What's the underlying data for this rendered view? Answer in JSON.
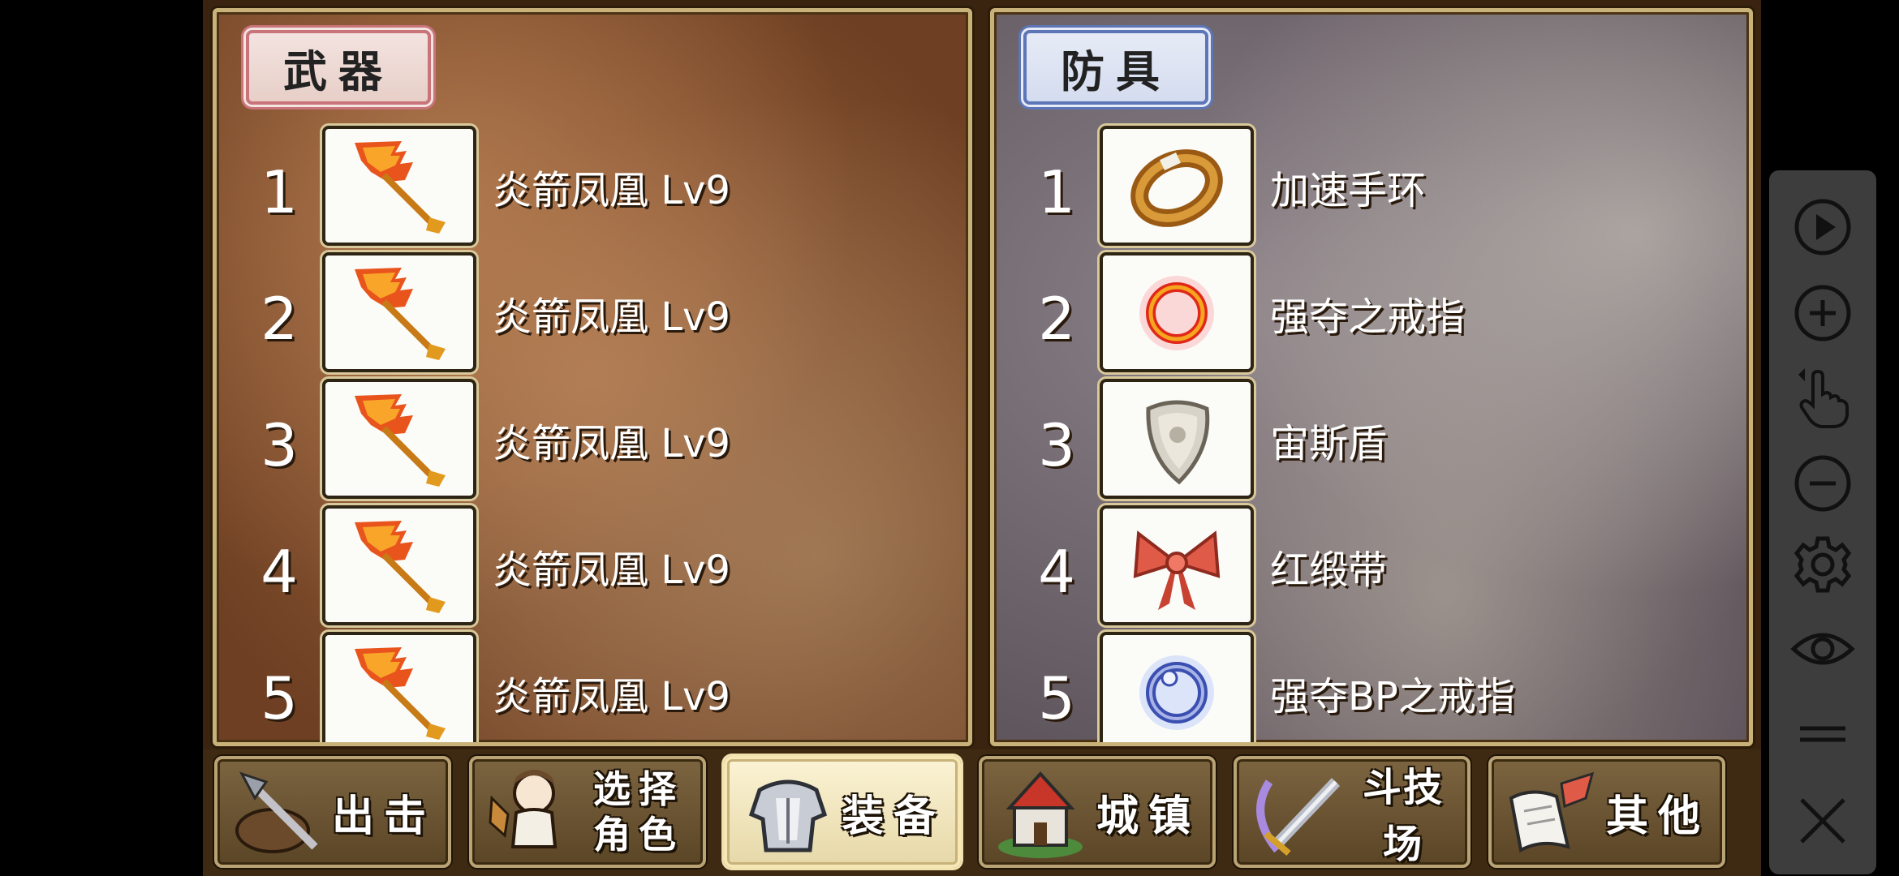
{
  "weapons": {
    "title": "武器",
    "items": [
      {
        "num": "1",
        "name": "炎箭凤凰 Lv9",
        "icon": "phoenix-flame-bow-icon"
      },
      {
        "num": "2",
        "name": "炎箭凤凰 Lv9",
        "icon": "phoenix-flame-bow-icon"
      },
      {
        "num": "3",
        "name": "炎箭凤凰 Lv9",
        "icon": "phoenix-flame-bow-icon"
      },
      {
        "num": "4",
        "name": "炎箭凤凰 Lv9",
        "icon": "phoenix-flame-bow-icon"
      },
      {
        "num": "5",
        "name": "炎箭凤凰 Lv9",
        "icon": "phoenix-flame-bow-icon"
      }
    ]
  },
  "armor": {
    "title": "防具",
    "items": [
      {
        "num": "1",
        "name": "加速手环",
        "icon": "bracelet-icon"
      },
      {
        "num": "2",
        "name": "强夺之戒指",
        "icon": "ring-icon"
      },
      {
        "num": "3",
        "name": "宙斯盾",
        "icon": "shield-icon"
      },
      {
        "num": "4",
        "name": "红缎带",
        "icon": "ribbon-icon"
      },
      {
        "num": "5",
        "name": "强夺BP之戒指",
        "icon": "blue-ring-icon"
      }
    ]
  },
  "tabs": [
    {
      "label": "出击",
      "icon": "hammer-icon"
    },
    {
      "label_line1": "选择",
      "label_line2": "角色",
      "icon": "character-icon"
    },
    {
      "label": "装备",
      "icon": "armor-icon",
      "active": true
    },
    {
      "label": "城镇",
      "icon": "town-icon"
    },
    {
      "label": "斗技场",
      "icon": "sword-icon"
    },
    {
      "label": "其他",
      "icon": "scroll-icon"
    }
  ],
  "toolbar": [
    "play-icon",
    "zoom-in-icon",
    "tap-gesture-icon",
    "zoom-out-icon",
    "settings-icon",
    "eye-icon",
    "menu-icon",
    "close-icon"
  ]
}
